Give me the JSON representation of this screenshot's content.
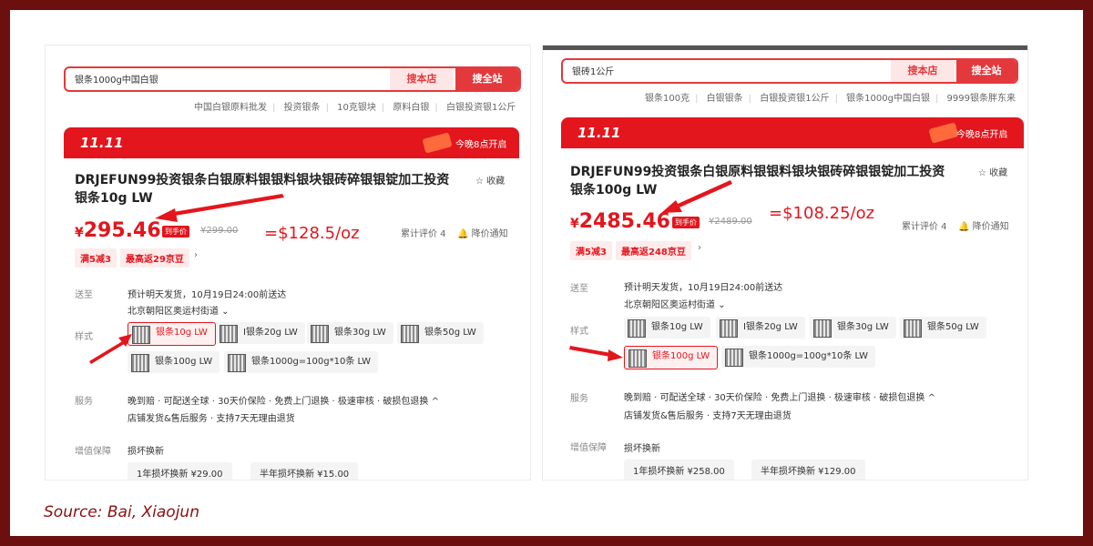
{
  "caption": "Source: Bai, Xiaojun",
  "left": {
    "search_value": "银条1000g中国白银",
    "btn_shop": "搜本店",
    "btn_all": "搜全站",
    "hot_links": [
      "中国白银原料批发",
      "投资银条",
      "10克银块",
      "原料白银",
      "白银投资银1公斤"
    ],
    "banner_logo": "11.11",
    "banner_right": "今晚8点开启",
    "title": "DRJEFUN99投资银条白银原料银银料银块银砖碎银银锭加工投资 银条10g LW",
    "fav": "☆ 收藏",
    "price_currency": "¥",
    "price": "295.46",
    "price_tag": "到手价",
    "old_price": "¥299.00",
    "annotation": "=$128.5/oz",
    "reviews": "累计评价 4",
    "notify": "降价通知",
    "coupon1": "满5减3",
    "coupon2": "最高返29京豆",
    "ship_label": "送至",
    "ship_info": "预计明天发货，10月19日24:00前送达",
    "address": "北京朝阳区奥运村街道 ⌄",
    "style_label": "样式",
    "styles": [
      "银条10g LW",
      "I银条20g LW",
      "银条30g LW",
      "银条50g LW",
      "银条100g LW",
      "银条1000g=100g*10条 LW"
    ],
    "service_label": "服务",
    "service_line1": "晚到赔 · 可配送全球 · 30天价保险 · 免费上门退换 · 极速审核 · 破损包退换 ^",
    "service_line2": "店铺发货&售后服务 · 支持7天无理由退货",
    "vas_label": "增值保障",
    "vas_title": "损坏换新",
    "vas_opt1": "1年损坏换新  ¥29.00",
    "vas_opt2": "半年损坏换新  ¥15.00"
  },
  "right": {
    "search_value": "银砖1公斤",
    "btn_shop": "搜本店",
    "btn_all": "搜全站",
    "hot_links": [
      "银条100克",
      "白银银条",
      "白银投资银1公斤",
      "银条1000g中国白银",
      "9999银条胖东来"
    ],
    "banner_logo": "11.11",
    "banner_right": "今晚8点开启",
    "title": "DRJEFUN99投资银条白银原料银银料银块银砖碎银银锭加工投资 银条100g LW",
    "fav": "☆ 收藏",
    "price_currency": "¥",
    "price": "2485.46",
    "price_tag": "到手价",
    "old_price": "¥2489.00",
    "annotation": "=$108.25/oz",
    "reviews": "累计评价 4",
    "notify": "降价通知",
    "coupon1": "满5减3",
    "coupon2": "最高返248京豆",
    "ship_label": "送至",
    "ship_info": "预计明天发货，10月19日24:00前送达",
    "address": "北京朝阳区奥运村街道 ⌄",
    "style_label": "样式",
    "styles": [
      "银条10g LW",
      "I银条20g LW",
      "银条30g LW",
      "银条50g LW",
      "银条100g LW",
      "银条1000g=100g*10条 LW"
    ],
    "service_label": "服务",
    "service_line1": "晚到赔 · 可配送全球 · 30天价保险 · 免费上门退换 · 极速审核 · 破损包退换 ^",
    "service_line2": "店铺发货&售后服务 · 支持7天无理由退货",
    "vas_label": "增值保障",
    "vas_title": "损坏换新",
    "vas_opt1": "1年损坏换新  ¥258.00",
    "vas_opt2": "半年损坏换新  ¥129.00"
  }
}
